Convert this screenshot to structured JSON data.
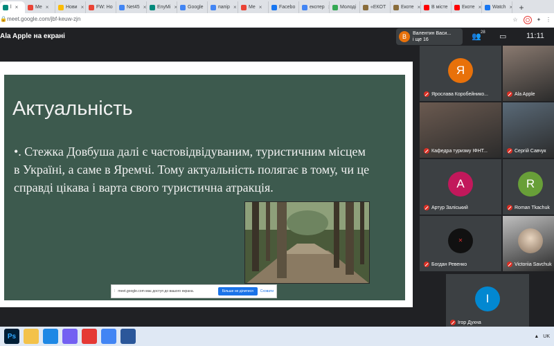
{
  "browser": {
    "tabs": [
      {
        "label": "l",
        "icon": "meet-icon",
        "color": "#00897b"
      },
      {
        "label": "Me",
        "icon": "gmail-icon",
        "color": "#ea4335"
      },
      {
        "label": "Нови",
        "icon": "news-icon",
        "color": "#fbbc04"
      },
      {
        "label": "FW: Ho",
        "icon": "mail-icon",
        "color": "#ea4335"
      },
      {
        "label": "Net45",
        "icon": "chrome-icon",
        "color": "#4285f4"
      },
      {
        "label": "EnyMi",
        "icon": "meet-icon",
        "color": "#00897b"
      },
      {
        "label": "Google",
        "icon": "google-icon",
        "color": "#4285f4"
      },
      {
        "label": "папір",
        "icon": "google-icon",
        "color": "#4285f4"
      },
      {
        "label": "Me",
        "icon": "gmail-icon",
        "color": "#ea4335"
      },
      {
        "label": "Facebo",
        "icon": "facebook-icon",
        "color": "#1877f2"
      },
      {
        "label": "екотер",
        "icon": "google-icon",
        "color": "#4285f4"
      },
      {
        "label": "Молоді",
        "icon": "site-icon",
        "color": "#34a853"
      },
      {
        "label": "«ЕКОТ",
        "icon": "site-icon",
        "color": "#8a6d3b"
      },
      {
        "label": "Екоте",
        "icon": "site-icon",
        "color": "#8a6d3b"
      },
      {
        "label": "В місте",
        "icon": "youtube-icon",
        "color": "#ff0000"
      },
      {
        "label": "Екоте",
        "icon": "youtube-icon",
        "color": "#ff0000"
      },
      {
        "label": "Watch",
        "icon": "facebook-icon",
        "color": "#1877f2"
      }
    ],
    "new_tab": "+",
    "url": "meet.google.com/jbf-keuw-zjn"
  },
  "meet": {
    "presenting_label": "Ala Apple на екрані",
    "presenter": {
      "initial": "В",
      "name": "Валентин Васи...",
      "sub": "і ще 16"
    },
    "people_count": "28",
    "clock": "11:11"
  },
  "slide": {
    "title": "Актуальність",
    "body": "•. Стежка Довбуша далі є частовідвідуваним, туристичним місцем в Україні, а саме в Яремчі. Тому актуальність полягає в тому, чи це справді цікава і варта свого туристична атракція.",
    "photo_alt": "forest-trail-photo"
  },
  "share_bar": {
    "text": "meet.google.com має доступ до вашого екрана.",
    "stop": "Більше не ділитися",
    "hide": "Сховати"
  },
  "participants": [
    {
      "name": "Ярослава Коробейнико...",
      "initial": "Я",
      "color": "#e8710a",
      "muted": true
    },
    {
      "name": "Ala Apple",
      "initial": "",
      "color": "#8a7a70",
      "muted": true,
      "video": true
    },
    {
      "name": "Кафедра туризму ІФНТ...",
      "initial": "",
      "color": "#6b5a50",
      "muted": true,
      "video": true
    },
    {
      "name": "Сергій Савчук",
      "initial": "",
      "color": "#5a6a78",
      "muted": true,
      "video": true
    },
    {
      "name": "Артур Заліський",
      "initial": "А",
      "color": "#c2185b",
      "muted": true
    },
    {
      "name": "Roman Tkachuk",
      "initial": "R",
      "color": "#689f38",
      "muted": true
    },
    {
      "name": "Богдан Ревенко",
      "initial": "",
      "color": "#111111",
      "muted": true,
      "logo": true
    },
    {
      "name": "Victoriia Savchuk",
      "initial": "",
      "color": "#bfbfbf",
      "muted": true,
      "photo": true
    },
    {
      "name": "Ігор Духна",
      "initial": "І",
      "color": "#0288d1",
      "muted": true
    }
  ],
  "taskbar": {
    "apps": [
      {
        "label": "Ps",
        "icon": "photoshop-icon",
        "color": "#001e36"
      },
      {
        "label": "",
        "icon": "folder-icon",
        "color": "#f3c24a"
      },
      {
        "label": "",
        "icon": "ie-icon",
        "color": "#1e88e5"
      },
      {
        "label": "",
        "icon": "viber-icon",
        "color": "#7360f2"
      },
      {
        "label": "",
        "icon": "screen-icon",
        "color": "#e53935"
      },
      {
        "label": "",
        "icon": "chrome-icon",
        "color": "#4285f4"
      },
      {
        "label": "",
        "icon": "word-icon",
        "color": "#2b579a"
      }
    ],
    "lang": "UK"
  }
}
